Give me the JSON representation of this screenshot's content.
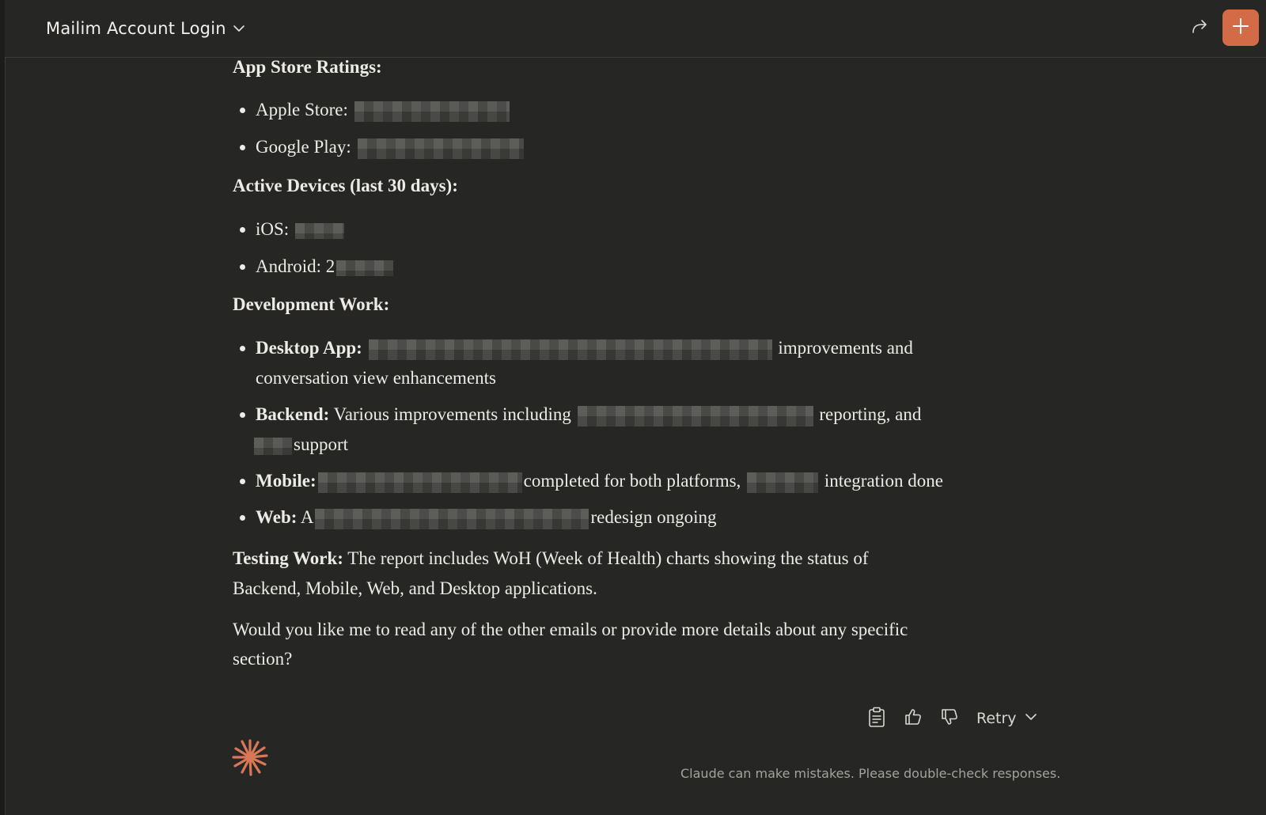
{
  "header": {
    "conversation_title": "Mailim Account Login",
    "title_chevron_icon": "chevron-down-icon",
    "share_icon": "share-arrow-icon",
    "new_chat_icon": "plus-icon",
    "accent_color": "#d36b47"
  },
  "message": {
    "app_store_heading": "App Store Ratings:",
    "app_store_items": [
      {
        "label": "Apple Store:"
      },
      {
        "label": "Google Play:"
      }
    ],
    "devices_heading": "Active Devices (last 30 days):",
    "device_items": [
      {
        "label": "iOS: "
      },
      {
        "label": "Android: 2"
      }
    ],
    "dev_heading": "Development Work:",
    "dev_items": {
      "desktop": {
        "label": "Desktop App:",
        "after": " improvements and",
        "continuation": "conversation view enhancements"
      },
      "backend": {
        "label": "Backend:",
        "before": " Various improvements including ",
        "after": " reporting, and",
        "continuation": "support"
      },
      "mobile": {
        "label": "Mobile:",
        "after": "completed for both platforms, ",
        "after2": " integration done"
      },
      "web": {
        "label": "Web:",
        "before": " A",
        "after": "redesign ongoing"
      }
    },
    "testing": {
      "label": "Testing Work:",
      "text": " The report includes WoH (Week of Health) charts showing the status of",
      "continuation": "Backend, Mobile, Web, and Desktop applications."
    },
    "closing": {
      "line1": "Would you like me to read any of the other emails or provide more details about any specific",
      "line2": "section?"
    }
  },
  "actions": {
    "copy_icon": "clipboard-icon",
    "thumbs_up_icon": "thumbs-up-icon",
    "thumbs_down_icon": "thumbs-down-icon",
    "retry_label": "Retry",
    "retry_chevron_icon": "chevron-down-icon"
  },
  "footer": {
    "assistant_logo_icon": "claude-spark-icon",
    "disclaimer": "Claude can make mistakes. Please double-check responses."
  }
}
